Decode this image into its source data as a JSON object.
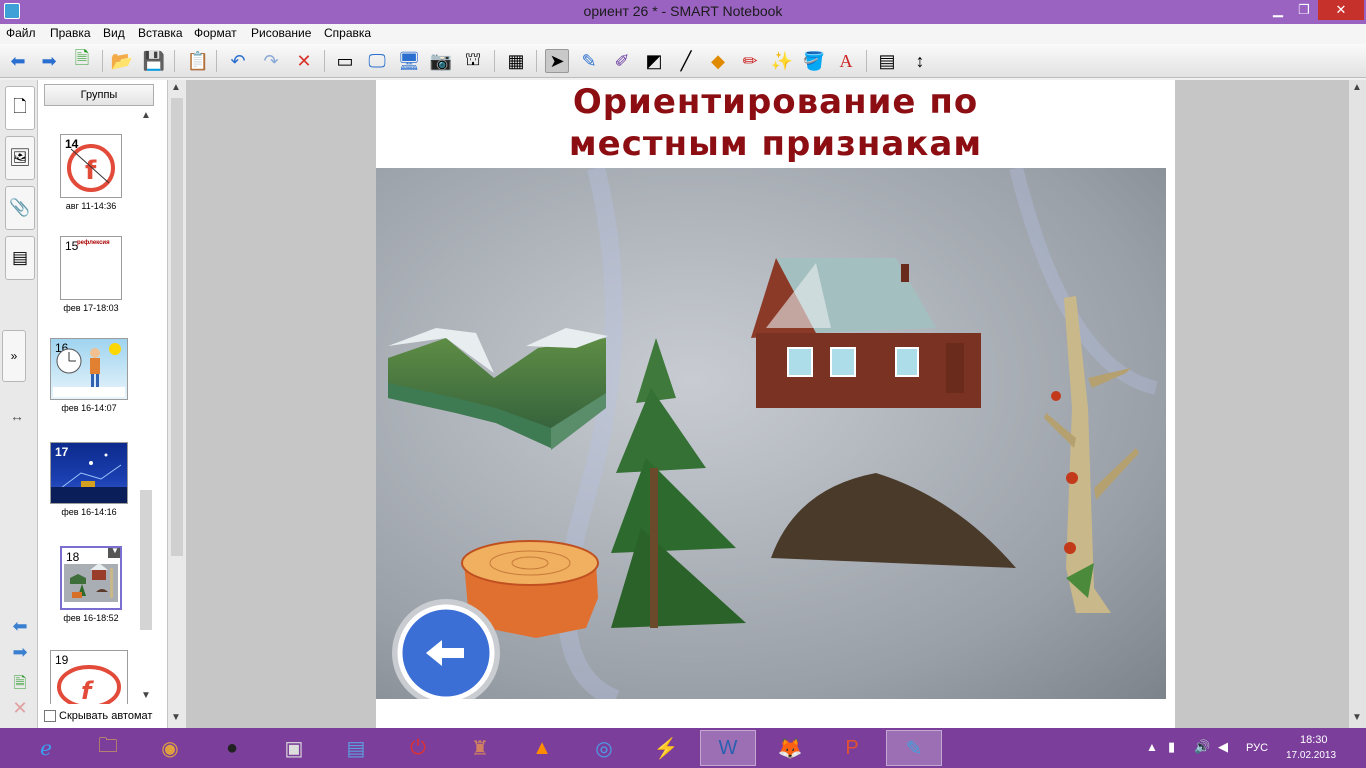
{
  "window": {
    "title": "ориент 26 * - SMART Notebook"
  },
  "menu": [
    "Файл",
    "Правка",
    "Вид",
    "Вставка",
    "Формат",
    "Рисование",
    "Справка"
  ],
  "toolbar_icons": [
    "back-icon",
    "forward-icon",
    "add-page-icon",
    "open-icon",
    "save-icon",
    "paste-icon",
    "undo-icon",
    "redo-icon",
    "delete-icon",
    "screen-shade-icon",
    "full-screen-icon",
    "dual-page-icon",
    "screen-capture-icon",
    "document-camera-icon",
    "table-icon",
    "select-icon",
    "pen-icon",
    "creative-pen-icon",
    "eraser-icon",
    "line-icon",
    "shapes-icon",
    "fill-pen-icon",
    "magic-pen-icon",
    "fill-icon",
    "text-icon",
    "properties-icon",
    "move-toolbar-icon"
  ],
  "sorter": {
    "groups_label": "Группы",
    "pages": [
      {
        "num": "14",
        "caption": "авг 11-14:36"
      },
      {
        "num": "15",
        "caption": "фев 17-18:03"
      },
      {
        "num": "16",
        "caption": "фев 16-14:07"
      },
      {
        "num": "17",
        "caption": "фев 16-14:16"
      },
      {
        "num": "18",
        "caption": "фев 16-18:52"
      },
      {
        "num": "19",
        "caption": ""
      }
    ],
    "page15_title": "рефлексия",
    "hide_auto_label": "Скрывать автомат"
  },
  "page": {
    "title_line1": "Ориентирование  по",
    "title_line2": "местным  признакам"
  },
  "taskbar": {
    "apps": [
      "internet-explorer-icon",
      "file-explorer-icon",
      "media-icon",
      "speaker-app-icon",
      "doc-icon",
      "tool-icon",
      "power-icon",
      "game-icon",
      "vlc-icon",
      "eye-icon",
      "slash-icon",
      "word-icon",
      "firefox-icon",
      "powerpoint-icon",
      "smart-notebook-icon"
    ],
    "lang": "РУС",
    "time": "18:30",
    "date": "17.02.2013"
  }
}
